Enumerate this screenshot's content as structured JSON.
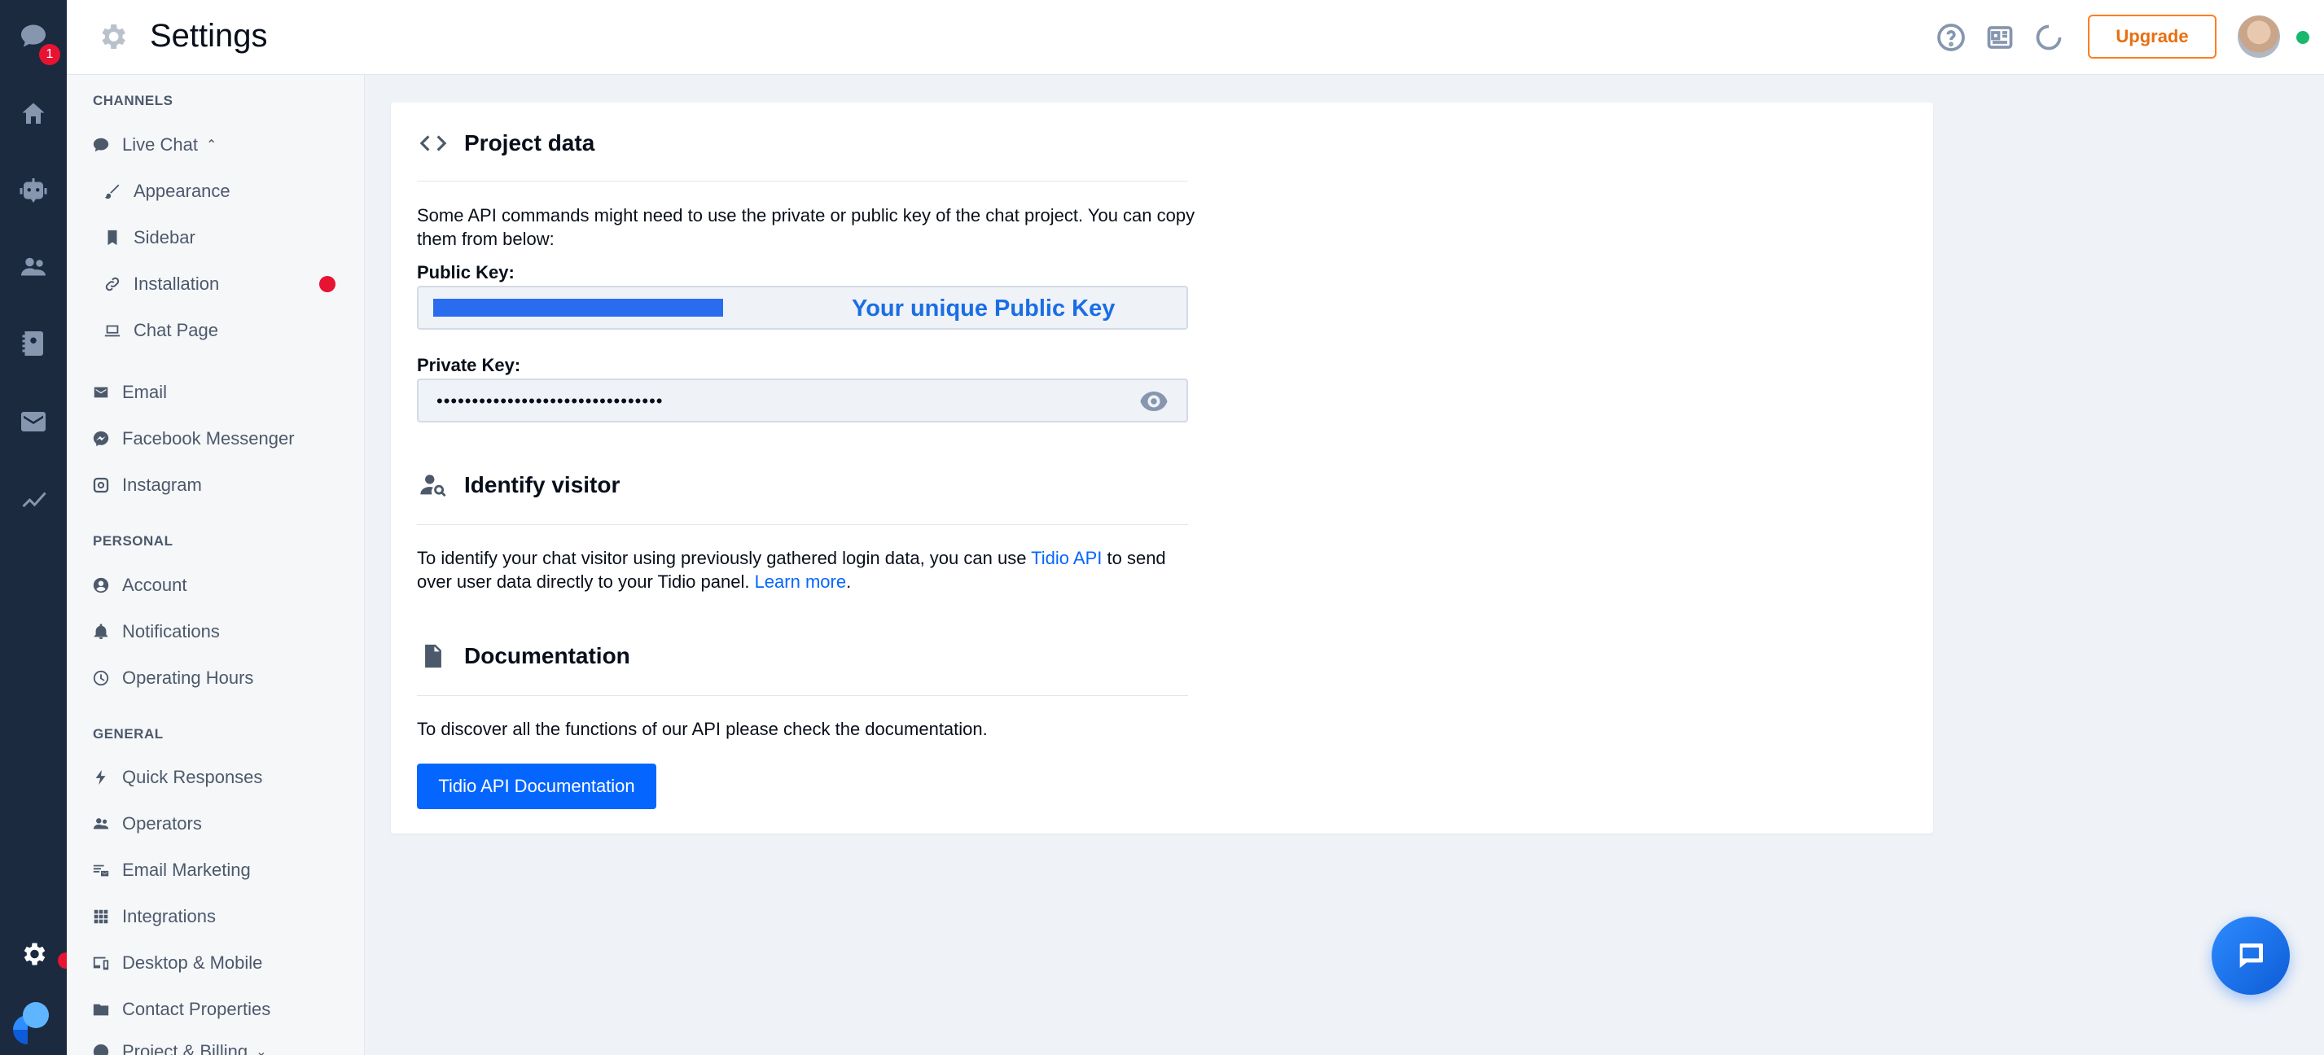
{
  "rail": {
    "badge_count": "1"
  },
  "topbar": {
    "title": "Settings",
    "upgrade_label": "Upgrade"
  },
  "sidebar": {
    "sections": {
      "channels": "CHANNELS",
      "personal": "PERSONAL",
      "general": "GENERAL"
    },
    "items": {
      "live_chat": "Live Chat",
      "appearance": "Appearance",
      "sidebar": "Sidebar",
      "installation": "Installation",
      "chat_page": "Chat Page",
      "email": "Email",
      "facebook_messenger": "Facebook Messenger",
      "instagram": "Instagram",
      "account": "Account",
      "notifications": "Notifications",
      "operating_hours": "Operating Hours",
      "quick_responses": "Quick Responses",
      "operators": "Operators",
      "email_marketing": "Email Marketing",
      "integrations": "Integrations",
      "desktop_mobile": "Desktop & Mobile",
      "contact_properties": "Contact Properties",
      "project_billing": "Project & Billing"
    }
  },
  "main": {
    "project_data": {
      "title": "Project data",
      "description": "Some API commands might need to use the private or public key of the chat project. You can copy them from below:",
      "public_key_label": "Public Key:",
      "public_key_caption": "Your unique Public Key",
      "private_key_label": "Private Key:",
      "private_key_value": "••••••••••••••••••••••••••••••••"
    },
    "identify_visitor": {
      "title": "Identify visitor",
      "text_before": "To identify your chat visitor using previously gathered login data, you can use ",
      "api_link": "Tidio API",
      "text_middle": " to send over user data directly to your Tidio panel. ",
      "learn_more": "Learn more",
      "text_end": "."
    },
    "documentation": {
      "title": "Documentation",
      "description": "To discover all the functions of our API please check the documentation.",
      "button_label": "Tidio API Documentation"
    }
  },
  "colors": {
    "accent": "#0566ff",
    "rail": "#1c2a3f",
    "upgrade": "#ff7d1e",
    "alert": "#e81332"
  },
  "icons": {
    "rail": [
      "chat-icon",
      "home-icon",
      "bot-icon",
      "visitors-icon",
      "contacts-icon",
      "inbox-icon",
      "analytics-icon",
      "settings-icon",
      "tidio-logo"
    ],
    "topbar": [
      "help-icon",
      "news-icon",
      "loader-icon"
    ]
  }
}
